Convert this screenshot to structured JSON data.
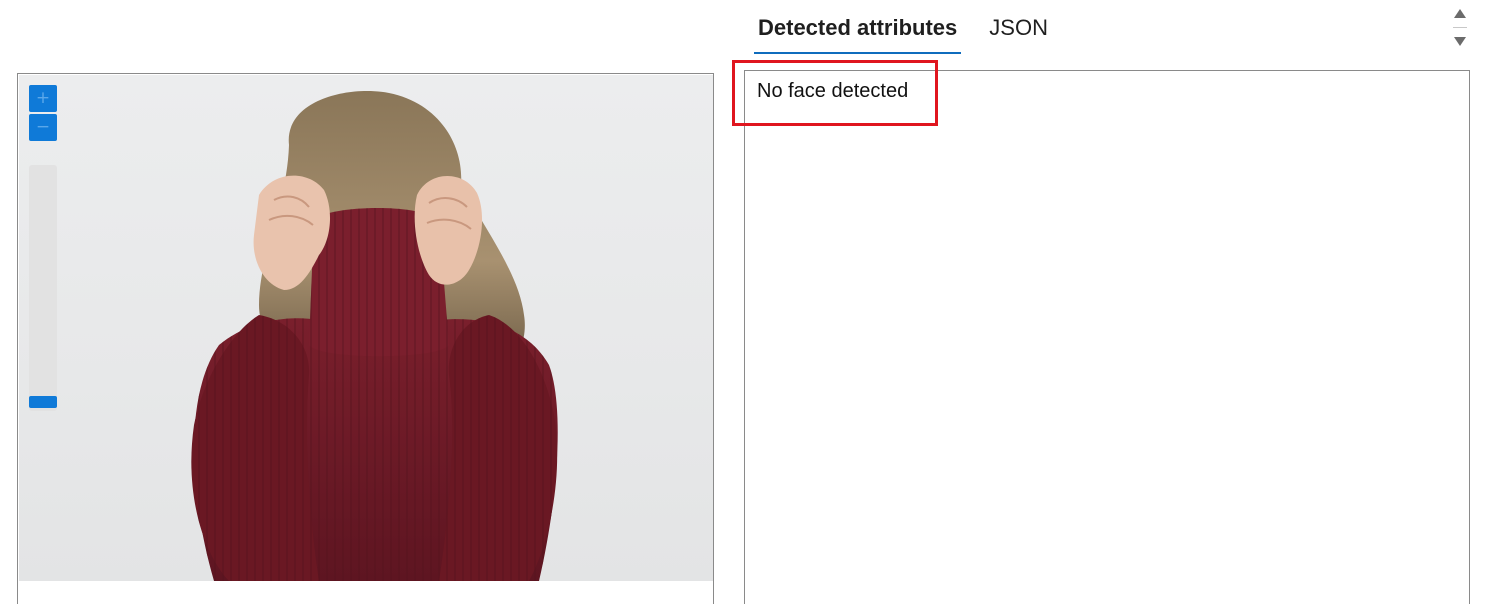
{
  "tabs": [
    {
      "label": "Detected attributes",
      "active": true
    },
    {
      "label": "JSON",
      "active": false
    }
  ],
  "result": {
    "text": "No face detected"
  },
  "viewer": {
    "zoom_in_symbol": "+",
    "zoom_out_symbol": "−",
    "zoom_level": 0,
    "image_subject": "woman in burgundy turtleneck covering face with collar"
  },
  "icons": {
    "scroll_up": "chevron-up-icon",
    "scroll_down": "chevron-down-icon"
  },
  "colors": {
    "accent": "#0f7ad8",
    "tab_underline": "#0f6cbd",
    "highlight": "#e0161f",
    "sweater": "#6d1a26"
  }
}
